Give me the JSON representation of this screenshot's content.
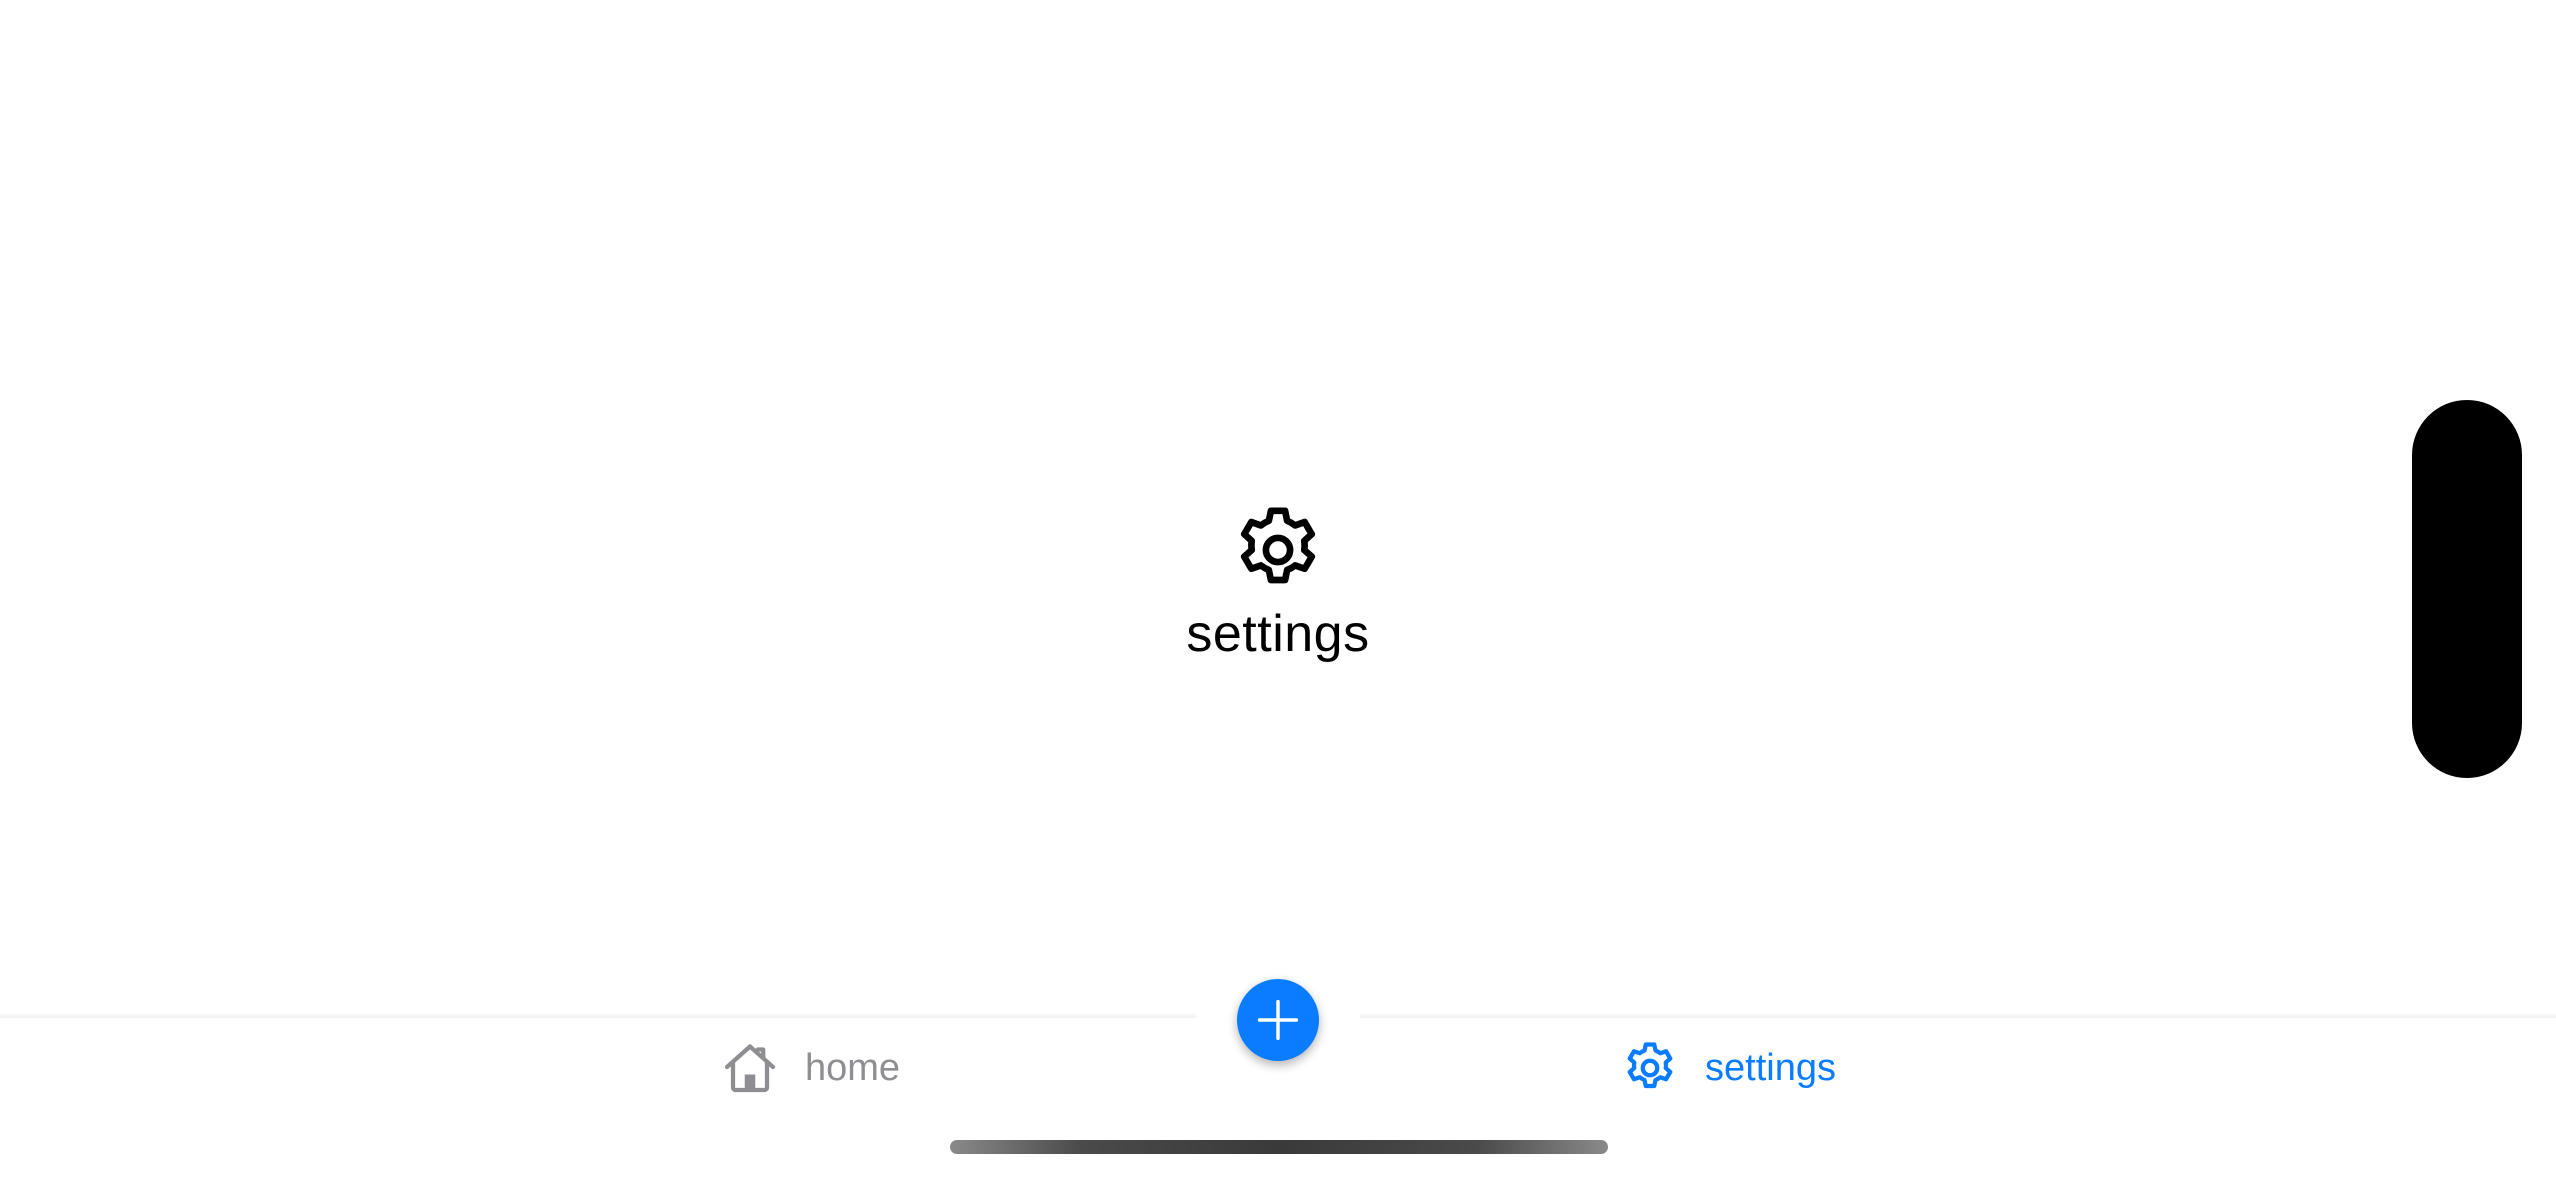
{
  "screen": {
    "title": "settings"
  },
  "tabbar": {
    "tabs": [
      {
        "label": "home",
        "icon": "house-icon",
        "selected": false,
        "color": "#8e8e93"
      },
      {
        "label": "settings",
        "icon": "gear-icon",
        "selected": true,
        "color": "#0a7cff"
      }
    ],
    "fab": {
      "icon": "plus-icon",
      "color": "#0a7cff"
    }
  },
  "colors": {
    "accent": "#0a7cff",
    "inactive": "#8e8e93",
    "background": "#ffffff",
    "text": "#000000"
  }
}
